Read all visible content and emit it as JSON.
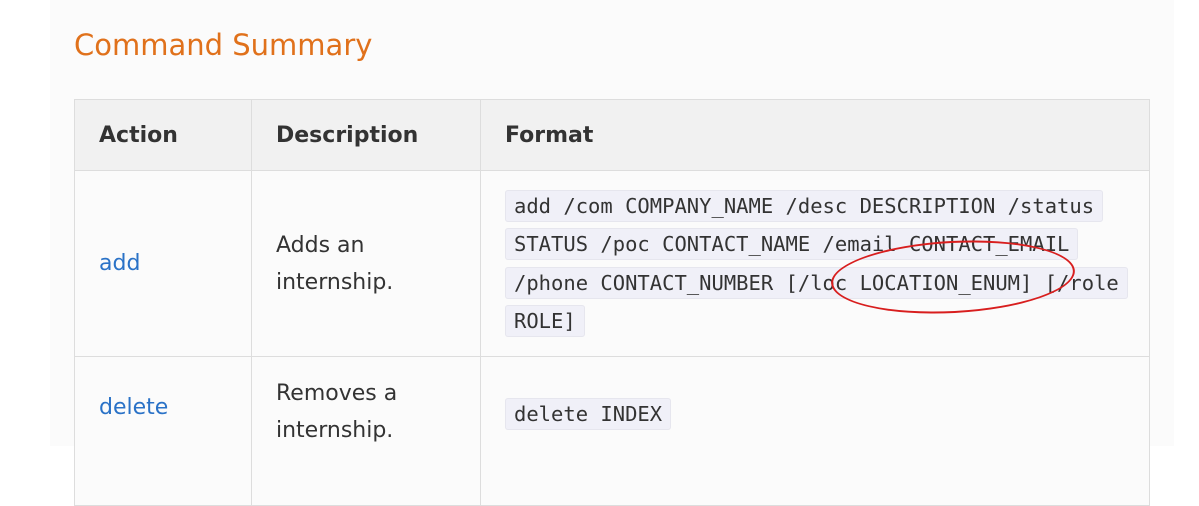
{
  "heading": "Command Summary",
  "table": {
    "headers": {
      "action": "Action",
      "description": "Description",
      "format": "Format"
    },
    "rows": [
      {
        "action": "add",
        "description": "Adds an internship.",
        "format": "add /com COMPANY_NAME /desc DESCRIPTION /status STATUS /poc CONTACT_NAME /email CONTACT_EMAIL /phone CONTACT_NUMBER [/loc LOCATION_ENUM] [/role ROLE]"
      },
      {
        "action": "delete",
        "description": "Removes a internship.",
        "format": "delete INDEX"
      }
    ]
  },
  "annotation": {
    "color": "#d81e1e",
    "target": "LOCATION_ENUM]"
  },
  "colors": {
    "heading": "#e0711b",
    "link": "#2a72c7"
  }
}
